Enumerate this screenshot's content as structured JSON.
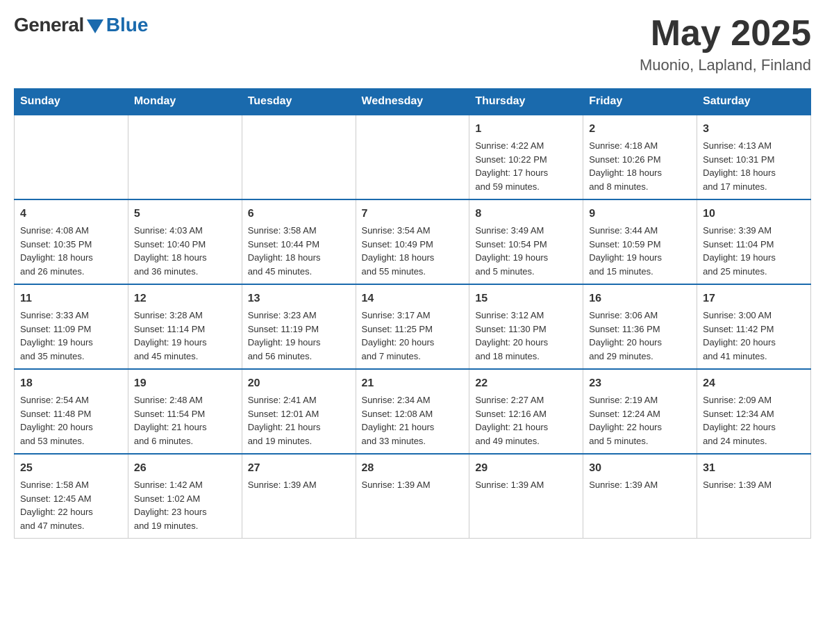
{
  "logo": {
    "general": "General",
    "blue": "Blue"
  },
  "title": {
    "month_year": "May 2025",
    "location": "Muonio, Lapland, Finland"
  },
  "days_of_week": [
    "Sunday",
    "Monday",
    "Tuesday",
    "Wednesday",
    "Thursday",
    "Friday",
    "Saturday"
  ],
  "weeks": [
    [
      {
        "day": "",
        "info": ""
      },
      {
        "day": "",
        "info": ""
      },
      {
        "day": "",
        "info": ""
      },
      {
        "day": "",
        "info": ""
      },
      {
        "day": "1",
        "info": "Sunrise: 4:22 AM\nSunset: 10:22 PM\nDaylight: 17 hours\nand 59 minutes."
      },
      {
        "day": "2",
        "info": "Sunrise: 4:18 AM\nSunset: 10:26 PM\nDaylight: 18 hours\nand 8 minutes."
      },
      {
        "day": "3",
        "info": "Sunrise: 4:13 AM\nSunset: 10:31 PM\nDaylight: 18 hours\nand 17 minutes."
      }
    ],
    [
      {
        "day": "4",
        "info": "Sunrise: 4:08 AM\nSunset: 10:35 PM\nDaylight: 18 hours\nand 26 minutes."
      },
      {
        "day": "5",
        "info": "Sunrise: 4:03 AM\nSunset: 10:40 PM\nDaylight: 18 hours\nand 36 minutes."
      },
      {
        "day": "6",
        "info": "Sunrise: 3:58 AM\nSunset: 10:44 PM\nDaylight: 18 hours\nand 45 minutes."
      },
      {
        "day": "7",
        "info": "Sunrise: 3:54 AM\nSunset: 10:49 PM\nDaylight: 18 hours\nand 55 minutes."
      },
      {
        "day": "8",
        "info": "Sunrise: 3:49 AM\nSunset: 10:54 PM\nDaylight: 19 hours\nand 5 minutes."
      },
      {
        "day": "9",
        "info": "Sunrise: 3:44 AM\nSunset: 10:59 PM\nDaylight: 19 hours\nand 15 minutes."
      },
      {
        "day": "10",
        "info": "Sunrise: 3:39 AM\nSunset: 11:04 PM\nDaylight: 19 hours\nand 25 minutes."
      }
    ],
    [
      {
        "day": "11",
        "info": "Sunrise: 3:33 AM\nSunset: 11:09 PM\nDaylight: 19 hours\nand 35 minutes."
      },
      {
        "day": "12",
        "info": "Sunrise: 3:28 AM\nSunset: 11:14 PM\nDaylight: 19 hours\nand 45 minutes."
      },
      {
        "day": "13",
        "info": "Sunrise: 3:23 AM\nSunset: 11:19 PM\nDaylight: 19 hours\nand 56 minutes."
      },
      {
        "day": "14",
        "info": "Sunrise: 3:17 AM\nSunset: 11:25 PM\nDaylight: 20 hours\nand 7 minutes."
      },
      {
        "day": "15",
        "info": "Sunrise: 3:12 AM\nSunset: 11:30 PM\nDaylight: 20 hours\nand 18 minutes."
      },
      {
        "day": "16",
        "info": "Sunrise: 3:06 AM\nSunset: 11:36 PM\nDaylight: 20 hours\nand 29 minutes."
      },
      {
        "day": "17",
        "info": "Sunrise: 3:00 AM\nSunset: 11:42 PM\nDaylight: 20 hours\nand 41 minutes."
      }
    ],
    [
      {
        "day": "18",
        "info": "Sunrise: 2:54 AM\nSunset: 11:48 PM\nDaylight: 20 hours\nand 53 minutes."
      },
      {
        "day": "19",
        "info": "Sunrise: 2:48 AM\nSunset: 11:54 PM\nDaylight: 21 hours\nand 6 minutes."
      },
      {
        "day": "20",
        "info": "Sunrise: 2:41 AM\nSunset: 12:01 AM\nDaylight: 21 hours\nand 19 minutes."
      },
      {
        "day": "21",
        "info": "Sunrise: 2:34 AM\nSunset: 12:08 AM\nDaylight: 21 hours\nand 33 minutes."
      },
      {
        "day": "22",
        "info": "Sunrise: 2:27 AM\nSunset: 12:16 AM\nDaylight: 21 hours\nand 49 minutes."
      },
      {
        "day": "23",
        "info": "Sunrise: 2:19 AM\nSunset: 12:24 AM\nDaylight: 22 hours\nand 5 minutes."
      },
      {
        "day": "24",
        "info": "Sunrise: 2:09 AM\nSunset: 12:34 AM\nDaylight: 22 hours\nand 24 minutes."
      }
    ],
    [
      {
        "day": "25",
        "info": "Sunrise: 1:58 AM\nSunset: 12:45 AM\nDaylight: 22 hours\nand 47 minutes."
      },
      {
        "day": "26",
        "info": "Sunrise: 1:42 AM\nSunset: 1:02 AM\nDaylight: 23 hours\nand 19 minutes."
      },
      {
        "day": "27",
        "info": "Sunrise: 1:39 AM"
      },
      {
        "day": "28",
        "info": "Sunrise: 1:39 AM"
      },
      {
        "day": "29",
        "info": "Sunrise: 1:39 AM"
      },
      {
        "day": "30",
        "info": "Sunrise: 1:39 AM"
      },
      {
        "day": "31",
        "info": "Sunrise: 1:39 AM"
      }
    ]
  ]
}
